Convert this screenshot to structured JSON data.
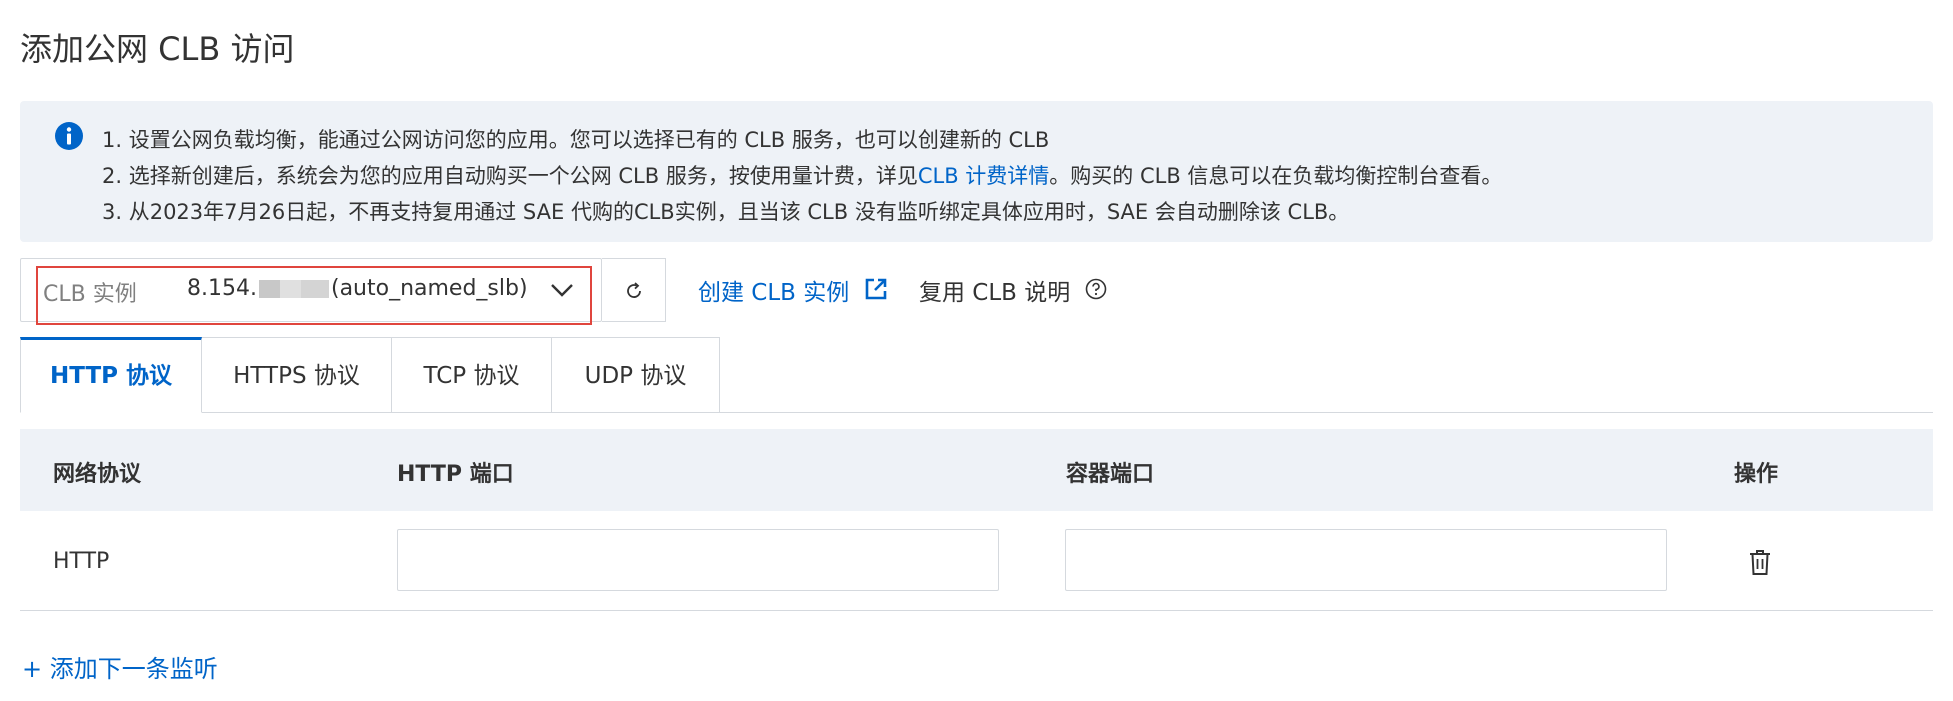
{
  "page": {
    "title": "添加公网 CLB 访问"
  },
  "notice": {
    "line1": "1. 设置公网负载均衡，能通过公网访问您的应用。您可以选择已有的 CLB 服务，也可以创建新的 CLB",
    "line2_pre": "2. 选择新创建后，系统会为您的应用自动购买一个公网 CLB 服务，按使用量计费，详见",
    "line2_link": "CLB 计费详情",
    "line2_post": "。购买的 CLB 信息可以在负载均衡控制台查看。",
    "line3": "3. 从2023年7月26日起，不再支持复用通过 SAE 代购的CLB实例，且当该 CLB 没有监听绑定具体应用时，SAE 会自动删除该 CLB。"
  },
  "clb": {
    "label": "CLB 实例",
    "value_prefix": "8.154.",
    "value_suffix": "(auto_named_slb)"
  },
  "actions": {
    "create_link": "创建 CLB 实例",
    "reuse_text": "复用 CLB 说明"
  },
  "tabs": [
    {
      "label": "HTTP 协议",
      "active": true
    },
    {
      "label": "HTTPS 协议",
      "active": false
    },
    {
      "label": "TCP 协议",
      "active": false
    },
    {
      "label": "UDP 协议",
      "active": false
    }
  ],
  "table": {
    "headers": {
      "protocol": "网络协议",
      "http_port": "HTTP 端口",
      "container_port": "容器端口",
      "actions": "操作"
    },
    "rows": [
      {
        "protocol": "HTTP",
        "http_port": "",
        "container_port": ""
      }
    ]
  },
  "add_listener": "+ 添加下一条监听",
  "colors": {
    "accent": "#0064c8",
    "highlight": "#e0453d",
    "notice_bg": "#eef2f7"
  }
}
